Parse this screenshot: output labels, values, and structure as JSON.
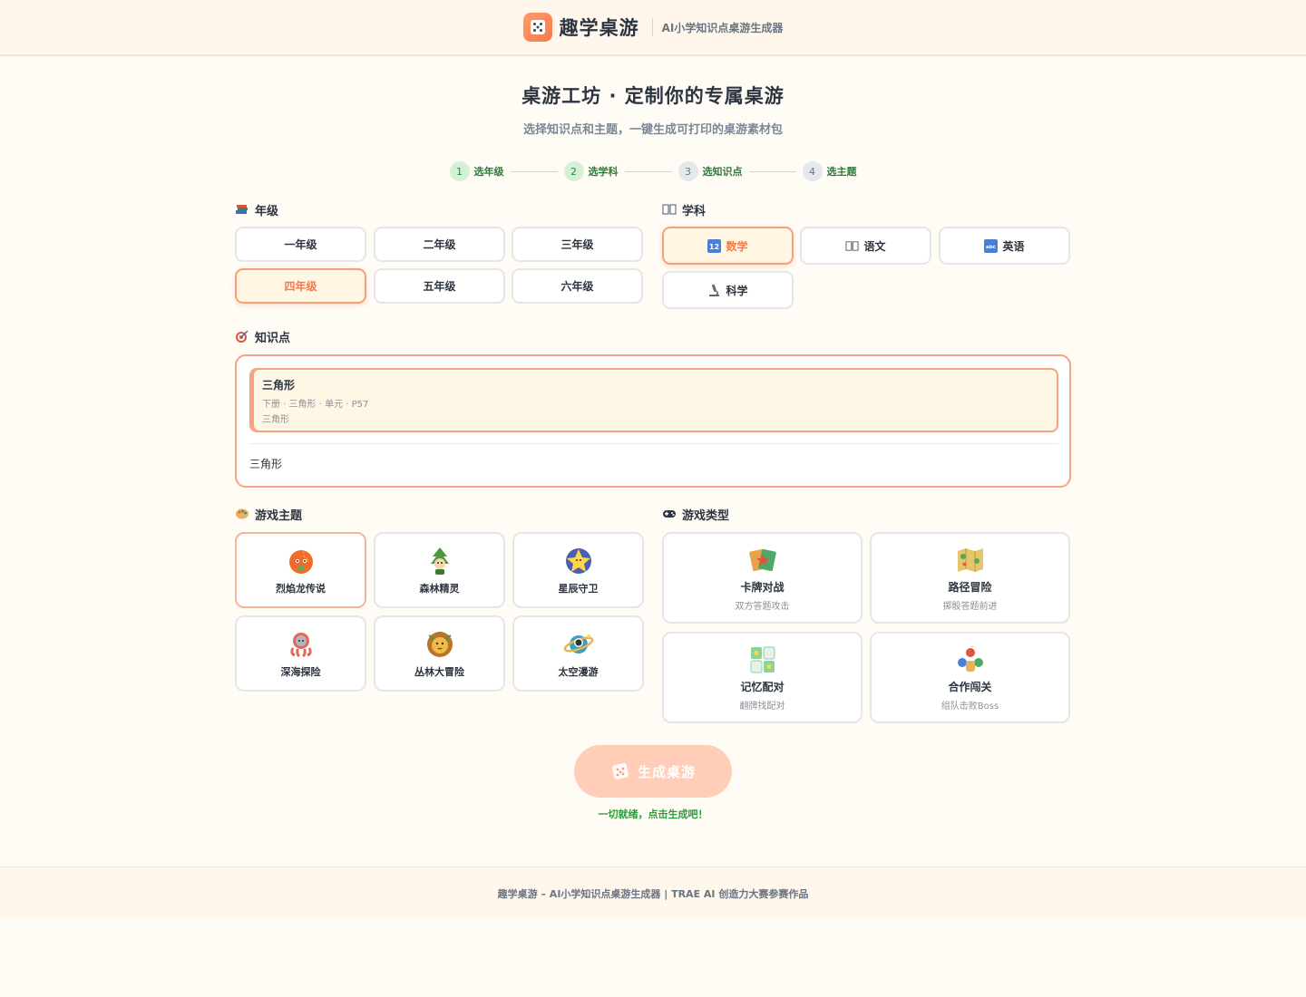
{
  "header": {
    "brand_name": "趣学桌游",
    "tagline": "AI小学知识点桌游生成器"
  },
  "hero": {
    "title": "桌游工坊 · 定制你的专属桌游",
    "subtitle": "选择知识点和主题，一键生成可打印的桌游素材包"
  },
  "steps": [
    {
      "num": "1",
      "label": "选年级"
    },
    {
      "num": "2",
      "label": "选学科"
    },
    {
      "num": "3",
      "label": "选知识点"
    },
    {
      "num": "4",
      "label": "选主题"
    }
  ],
  "grade": {
    "label": "年级",
    "options": [
      "一年级",
      "二年级",
      "三年级",
      "四年级",
      "五年级",
      "六年级"
    ],
    "selected": "四年级"
  },
  "subject": {
    "label": "学科",
    "options": [
      "数学",
      "语文",
      "英语",
      "科学"
    ],
    "selected": "数学"
  },
  "knowledge": {
    "label": "知识点",
    "card_title": "三角形",
    "card_meta": "下册 · 三角形 · 单元 · P57",
    "card_desc": "三角形",
    "input_value": "三角形"
  },
  "theme": {
    "label": "游戏主题",
    "options": [
      "烈焰龙传说",
      "森林精灵",
      "星辰守卫",
      "深海探险",
      "丛林大冒险",
      "太空漫游"
    ],
    "selected": "烈焰龙传说"
  },
  "game_type": {
    "label": "游戏类型",
    "options": [
      {
        "name": "卡牌对战",
        "desc": "双方答题攻击"
      },
      {
        "name": "路径冒险",
        "desc": "掷骰答题前进"
      },
      {
        "name": "记忆配对",
        "desc": "翻牌找配对"
      },
      {
        "name": "合作闯关",
        "desc": "组队击败Boss"
      }
    ]
  },
  "actions": {
    "generate_label": "生成桌游",
    "ready_text": "一切就绪，点击生成吧！"
  },
  "footer": {
    "text": "趣学桌游 – AI小学知识点桌游生成器 | TRAE AI 创造力大赛参赛作品"
  },
  "colors": {
    "accent": "#f47a4c",
    "accent_border": "#f5a385",
    "selected_bg": "#fff6e4",
    "step_green": "#2f8a3a",
    "page_bg": "#fffcf6"
  }
}
